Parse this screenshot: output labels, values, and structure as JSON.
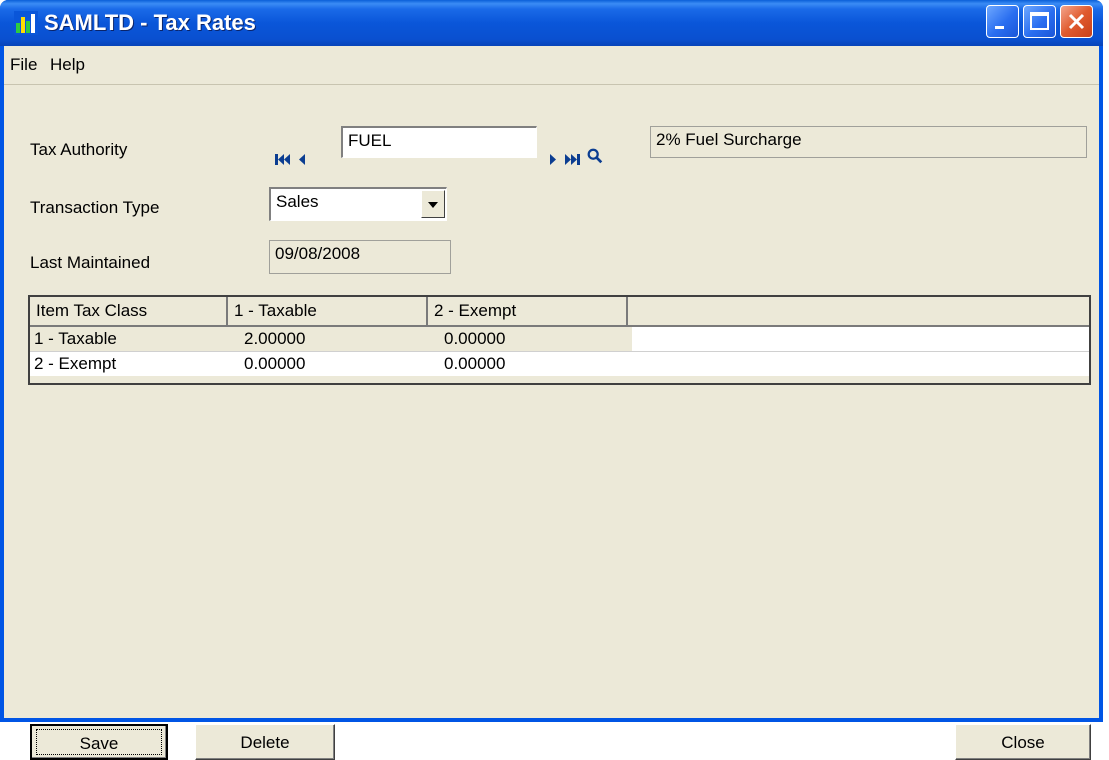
{
  "window": {
    "title": "SAMLTD - Tax Rates"
  },
  "menu": {
    "file": "File",
    "help": "Help"
  },
  "form": {
    "tax_authority_label": "Tax Authority",
    "tax_authority_code": "FUEL",
    "tax_authority_desc": "2% Fuel Surcharge",
    "transaction_type_label": "Transaction Type",
    "transaction_type_value": "Sales",
    "last_maintained_label": "Last Maintained",
    "last_maintained_value": "09/08/2008"
  },
  "grid": {
    "headers": [
      "Item Tax Class",
      "1 - Taxable",
      "2 - Exempt"
    ],
    "rows": [
      [
        "1 - Taxable",
        "2.00000",
        "0.00000"
      ],
      [
        "2 - Exempt",
        "0.00000",
        "0.00000"
      ]
    ]
  },
  "buttons": {
    "save": "Save",
    "delete": "Delete",
    "close": "Close"
  },
  "colors": {
    "titlebar": "#0a56d9",
    "face": "#ece9d8",
    "close_button": "#e05a2e",
    "nav_arrow": "#0b3d91"
  }
}
